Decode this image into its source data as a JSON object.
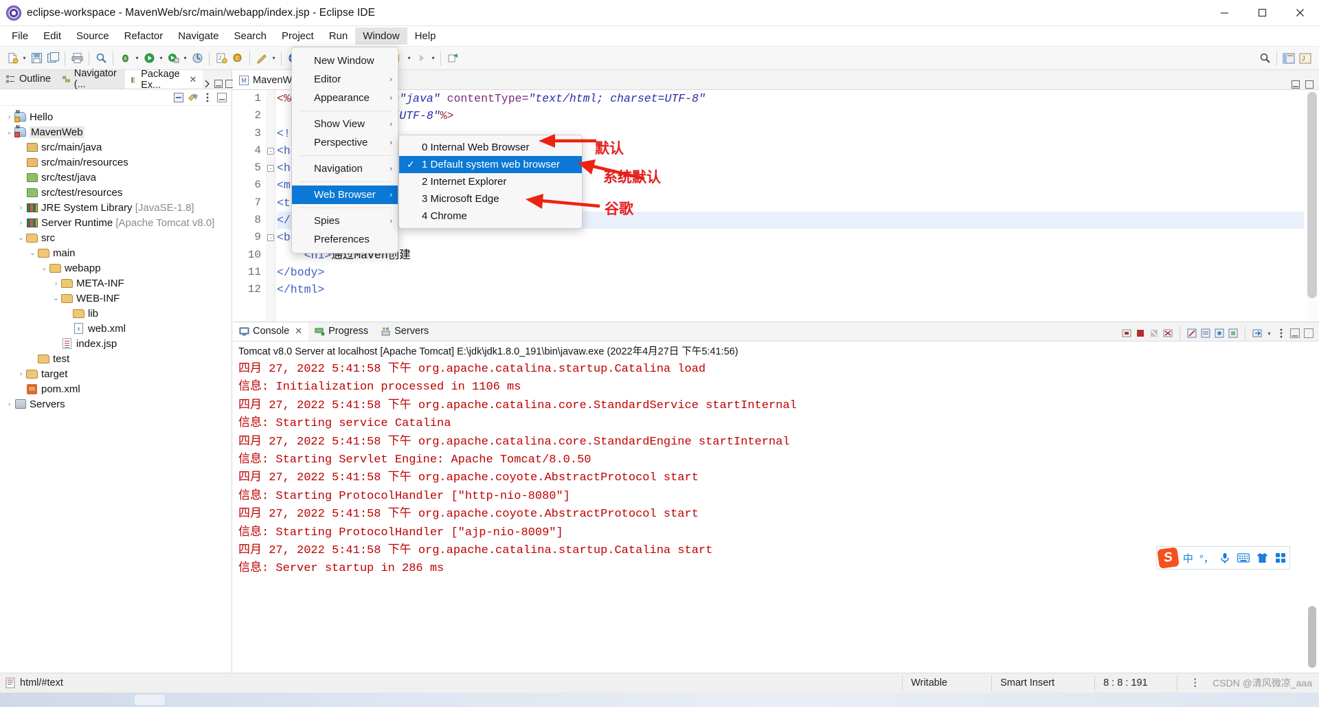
{
  "window": {
    "title": "eclipse-workspace - MavenWeb/src/main/webapp/index.jsp - Eclipse IDE",
    "app_icon": "eclipse-icon",
    "minimize": "—",
    "maximize": "❐",
    "close": "✕"
  },
  "menubar": {
    "items": [
      {
        "label": "File"
      },
      {
        "label": "Edit"
      },
      {
        "label": "Source"
      },
      {
        "label": "Refactor"
      },
      {
        "label": "Navigate"
      },
      {
        "label": "Search"
      },
      {
        "label": "Project"
      },
      {
        "label": "Run"
      },
      {
        "label": "Window",
        "active": true
      },
      {
        "label": "Help"
      }
    ]
  },
  "window_menu": {
    "items": [
      {
        "label": "New Window",
        "submenu": false
      },
      {
        "label": "Editor",
        "submenu": true
      },
      {
        "label": "Appearance",
        "submenu": true
      },
      {
        "label": "Show View",
        "submenu": true
      },
      {
        "label": "Perspective",
        "submenu": true
      },
      {
        "label": "Navigation",
        "submenu": true
      },
      {
        "label": "Web Browser",
        "submenu": true,
        "selected": true
      },
      {
        "label": "Spies",
        "submenu": true
      },
      {
        "label": "Preferences",
        "submenu": false
      }
    ],
    "submenu_arrow": "›"
  },
  "web_browser_submenu": {
    "items": [
      {
        "label": "0 Internal Web Browser",
        "checked": false,
        "selected": false
      },
      {
        "label": "1 Default system web browser",
        "checked": true,
        "selected": true
      },
      {
        "label": "2 Internet Explorer",
        "checked": false,
        "selected": false
      },
      {
        "label": "3 Microsoft Edge",
        "checked": false,
        "selected": false
      },
      {
        "label": "4 Chrome",
        "checked": false,
        "selected": false
      }
    ],
    "check_glyph": "✓"
  },
  "annotations": [
    {
      "text": "默认",
      "color": "#e32020"
    },
    {
      "text": "系统默认",
      "color": "#e32020"
    },
    {
      "text": "谷歌",
      "color": "#e32020"
    }
  ],
  "left_panel": {
    "tabs": [
      {
        "label": "Outline",
        "icon": "outline-icon",
        "active": false
      },
      {
        "label": "Navigator (...",
        "icon": "navigator-icon",
        "active": false
      },
      {
        "label": "Package Ex...",
        "icon": "package-explorer-icon",
        "active": true,
        "close": "✕"
      }
    ],
    "tree": [
      {
        "indent": 0,
        "arrow": "›",
        "icon": "maven-project-icon",
        "label": "Hello",
        "sub": "",
        "selected": false
      },
      {
        "indent": 0,
        "arrow": "⌄",
        "icon": "maven-project-error-icon",
        "label": "MavenWeb",
        "sub": "",
        "selected": true
      },
      {
        "indent": 1,
        "arrow": "",
        "icon": "source-folder-icon",
        "label": "src/main/java",
        "sub": "",
        "selected": false
      },
      {
        "indent": 1,
        "arrow": "",
        "icon": "source-folder-icon",
        "label": "src/main/resources",
        "sub": "",
        "selected": false
      },
      {
        "indent": 1,
        "arrow": "",
        "icon": "source-folder-green-icon",
        "label": "src/test/java",
        "sub": "",
        "selected": false
      },
      {
        "indent": 1,
        "arrow": "",
        "icon": "source-folder-green-icon",
        "label": "src/test/resources",
        "sub": "",
        "selected": false
      },
      {
        "indent": 1,
        "arrow": "›",
        "icon": "library-icon",
        "label": "JRE System Library",
        "sub": "[JavaSE-1.8]",
        "selected": false
      },
      {
        "indent": 1,
        "arrow": "›",
        "icon": "library-icon",
        "label": "Server Runtime",
        "sub": "[Apache Tomcat v8.0]",
        "selected": false
      },
      {
        "indent": 1,
        "arrow": "⌄",
        "icon": "folder-icon",
        "label": "src",
        "sub": "",
        "selected": false
      },
      {
        "indent": 2,
        "arrow": "⌄",
        "icon": "folder-icon",
        "label": "main",
        "sub": "",
        "selected": false
      },
      {
        "indent": 3,
        "arrow": "⌄",
        "icon": "folder-icon",
        "label": "webapp",
        "sub": "",
        "selected": false
      },
      {
        "indent": 4,
        "arrow": "›",
        "icon": "folder-icon",
        "label": "META-INF",
        "sub": "",
        "selected": false
      },
      {
        "indent": 4,
        "arrow": "⌄",
        "icon": "folder-icon",
        "label": "WEB-INF",
        "sub": "",
        "selected": false
      },
      {
        "indent": 5,
        "arrow": "",
        "icon": "folder-icon",
        "label": "lib",
        "sub": "",
        "selected": false
      },
      {
        "indent": 5,
        "arrow": "",
        "icon": "xml-file-icon",
        "label": "web.xml",
        "sub": "",
        "selected": false
      },
      {
        "indent": 4,
        "arrow": "",
        "icon": "jsp-file-icon",
        "label": "index.jsp",
        "sub": "",
        "selected": false
      },
      {
        "indent": 2,
        "arrow": "",
        "icon": "folder-icon",
        "label": "test",
        "sub": "",
        "selected": false
      },
      {
        "indent": 1,
        "arrow": "›",
        "icon": "folder-icon",
        "label": "target",
        "sub": "",
        "selected": false
      },
      {
        "indent": 1,
        "arrow": "",
        "icon": "pom-file-icon",
        "label": "pom.xml",
        "sub": "",
        "selected": false
      },
      {
        "indent": 0,
        "arrow": "›",
        "icon": "server-icon",
        "label": "Servers",
        "sub": "",
        "selected": false
      }
    ]
  },
  "editor": {
    "tab": {
      "label": "MavenW",
      "icon": "jsp-tab-icon",
      "close": "✕"
    },
    "lines": [
      {
        "no": "1",
        "fold": "",
        "html": "<span class='tok-dir'>&lt;%@</span> <span class='tok-pl'>page language=</span><span class='tok-val'>\"java\"</span> <span class='tok-attr'>contentType=</span><span class='tok-val'>\"text/html; charset=UTF-8\"</span>"
      },
      {
        "no": "2",
        "fold": "",
        "html": "<span class='tok-pl'>    pageEncoding=</span><span class='tok-val'>\"UTF-8\"</span><span class='tok-dir'>%&gt;</span>"
      },
      {
        "no": "3",
        "fold": "",
        "html": "<span class='tok-tag'>&lt;!DOCTYPE html&gt;</span>"
      },
      {
        "no": "4",
        "fold": "-",
        "html": "<span class='tok-tag'>&lt;html&gt;</span>"
      },
      {
        "no": "5",
        "fold": "-",
        "html": "<span class='tok-tag'>&lt;head&gt;</span>"
      },
      {
        "no": "6",
        "fold": "",
        "html": "<span class='tok-tag'>&lt;meta&gt;</span>"
      },
      {
        "no": "7",
        "fold": "",
        "html": "<span class='tok-tag'>&lt;title&gt;</span>"
      },
      {
        "no": "8",
        "fold": "",
        "html": "<span class='tok-tag'>&lt;/head&gt;</span>",
        "highlight": true
      },
      {
        "no": "9",
        "fold": "-",
        "html": "<span class='tok-tag'>&lt;body&gt;</span>"
      },
      {
        "no": "10",
        "fold": "",
        "html": "    <span class='tok-tag'>&lt;h1&gt;</span><span class='tok-pl'>通过Maven创建</span>"
      },
      {
        "no": "11",
        "fold": "",
        "html": "<span class='tok-tag'>&lt;/body&gt;</span>"
      },
      {
        "no": "12",
        "fold": "",
        "html": "<span class='tok-tag'>&lt;/html&gt;</span>"
      }
    ]
  },
  "console": {
    "tabs": [
      {
        "label": "Console",
        "icon": "console-icon",
        "active": true,
        "close": "✕"
      },
      {
        "label": "Progress",
        "icon": "progress-icon",
        "active": false
      },
      {
        "label": "Servers",
        "icon": "servers-icon",
        "active": false
      }
    ],
    "header": "Tomcat v8.0 Server at localhost [Apache Tomcat] E:\\jdk\\jdk1.8.0_191\\bin\\javaw.exe  (2022年4月27日 下午5:41:56)",
    "output": [
      "四月 27, 2022 5:41:58 下午 org.apache.catalina.startup.Catalina load",
      "信息: Initialization processed in 1106 ms",
      "四月 27, 2022 5:41:58 下午 org.apache.catalina.core.StandardService startInternal",
      "信息: Starting service Catalina",
      "四月 27, 2022 5:41:58 下午 org.apache.catalina.core.StandardEngine startInternal",
      "信息: Starting Servlet Engine: Apache Tomcat/8.0.50",
      "四月 27, 2022 5:41:58 下午 org.apache.coyote.AbstractProtocol start",
      "信息: Starting ProtocolHandler [\"http-nio-8080\"]",
      "四月 27, 2022 5:41:58 下午 org.apache.coyote.AbstractProtocol start",
      "信息: Starting ProtocolHandler [\"ajp-nio-8009\"]",
      "四月 27, 2022 5:41:58 下午 org.apache.catalina.startup.Catalina start",
      "信息: Server startup in 286 ms"
    ]
  },
  "statusbar": {
    "selection_icon": "document-icon",
    "selection": "html/#text",
    "writable": "Writable",
    "insert_mode": "Smart Insert",
    "position": "8 : 8 : 191",
    "more": "⋮",
    "watermark": "CSDN @清风微凉_aaa"
  },
  "ime": {
    "logo": "S",
    "items": [
      {
        "icon": "chinese-mode-icon",
        "glyph": "中"
      },
      {
        "icon": "punctuation-icon",
        "glyph": "°，"
      },
      {
        "icon": "microphone-icon",
        "glyph": "⸮"
      },
      {
        "icon": "keyboard-icon",
        "glyph": "⌨"
      },
      {
        "icon": "skin-icon",
        "glyph": "▼"
      },
      {
        "icon": "toolbox-icon",
        "glyph": "▒"
      }
    ]
  }
}
